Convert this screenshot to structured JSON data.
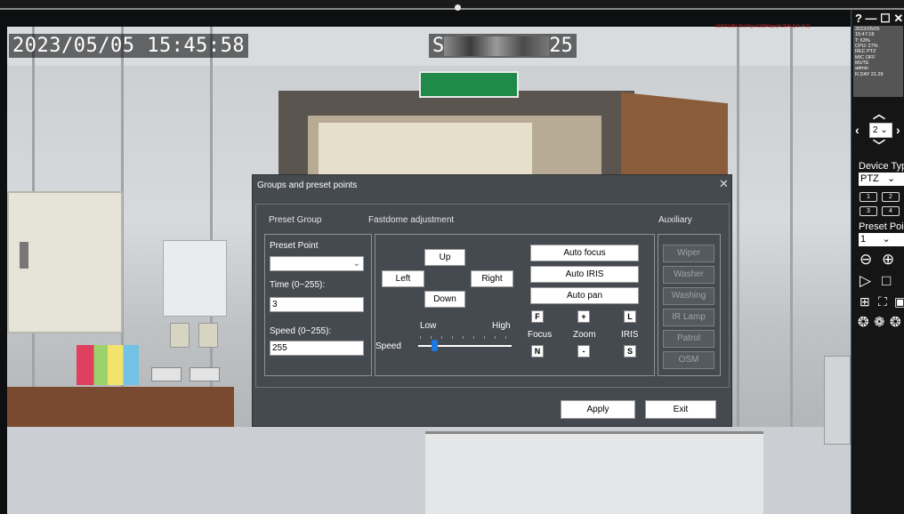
{
  "osd": {
    "datetime": "2023/05/05 15:45:58",
    "label_start": "S",
    "label_end": "25",
    "red_info": "1920*1080 29.97fps 5250Kbps(H.264) Q:5 (4.6)"
  },
  "right_panel": {
    "window_controls": "? — ☐ ✕",
    "info": [
      "2023/05/05",
      "15:47:18",
      "T: 63%",
      "CPU: 27%",
      "REC PTZ",
      "MIC OFF",
      "MUTE",
      "admin",
      "R.DAY 21.29"
    ],
    "channel_value": "2",
    "device_type_label": "Device Type",
    "device_type_value": "PTZ",
    "channel_buttons": [
      "1",
      "2",
      "3",
      "4"
    ],
    "preset_point_label": "Preset Point",
    "preset_point_value": "1",
    "icons": [
      "zoom-out-icon",
      "zoom-in-icon",
      "play-icon",
      "stop-icon",
      "fit-icon",
      "fullscreen-icon",
      "auto-icon"
    ]
  },
  "dialog": {
    "title": "Groups and preset points",
    "preset_group": {
      "heading": "Preset Group",
      "preset_point_label": "Preset Point",
      "preset_point_value": "",
      "time_label": "Time (0~255):",
      "time_value": "3",
      "speed_label": "Speed (0~255):",
      "speed_value": "255"
    },
    "fastdome": {
      "heading": "Fastdome adjustment",
      "up": "Up",
      "left": "Left",
      "right": "Right",
      "down": "Down",
      "low": "Low",
      "high": "High",
      "speed_label": "Speed",
      "speed_fraction": 0.18,
      "auto_focus": "Auto focus",
      "auto_iris": "Auto IRIS",
      "auto_pan": "Auto pan",
      "focus_near_btn": "F",
      "zoom_in_btn": "+",
      "iris_large_btn": "L",
      "focus_label": "Focus",
      "zoom_label": "Zoom",
      "iris_label": "IRIS",
      "focus_far_btn": "N",
      "zoom_out_btn": "-",
      "iris_small_btn": "S"
    },
    "auxiliary": {
      "heading": "Auxiliary",
      "buttons": [
        "Wiper",
        "Washer",
        "Washing",
        "IR Lamp",
        "Patrol",
        "OSM"
      ]
    },
    "apply": "Apply",
    "exit": "Exit"
  }
}
